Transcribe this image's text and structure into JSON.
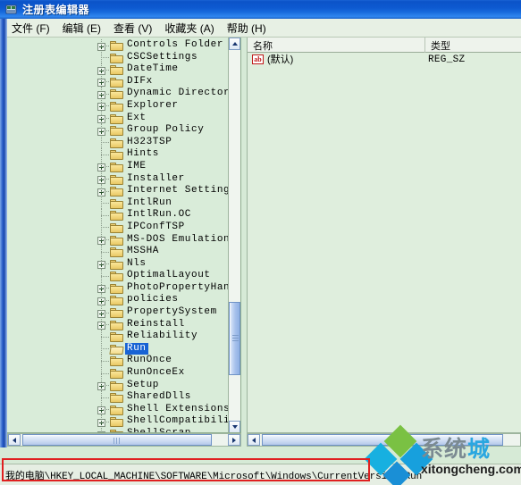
{
  "window": {
    "title": "注册表编辑器",
    "icon": "registry-editor-icon"
  },
  "menubar": {
    "items": [
      {
        "label": "文件 (F)",
        "name": "file"
      },
      {
        "label": "编辑 (E)",
        "name": "edit"
      },
      {
        "label": "查看 (V)",
        "name": "view"
      },
      {
        "label": "收藏夹 (A)",
        "name": "favorites"
      },
      {
        "label": "帮助 (H)",
        "name": "help"
      }
    ]
  },
  "tree": {
    "nodes": [
      {
        "label": "Controls Folder",
        "expandable": true,
        "selected": false
      },
      {
        "label": "CSCSettings",
        "expandable": false,
        "selected": false
      },
      {
        "label": "DateTime",
        "expandable": true,
        "selected": false
      },
      {
        "label": "DIFx",
        "expandable": true,
        "selected": false
      },
      {
        "label": "Dynamic Directory",
        "expandable": true,
        "selected": false
      },
      {
        "label": "Explorer",
        "expandable": true,
        "selected": false
      },
      {
        "label": "Ext",
        "expandable": true,
        "selected": false
      },
      {
        "label": "Group Policy",
        "expandable": true,
        "selected": false
      },
      {
        "label": "H323TSP",
        "expandable": false,
        "selected": false
      },
      {
        "label": "Hints",
        "expandable": false,
        "selected": false
      },
      {
        "label": "IME",
        "expandable": true,
        "selected": false
      },
      {
        "label": "Installer",
        "expandable": true,
        "selected": false
      },
      {
        "label": "Internet Settings",
        "expandable": true,
        "selected": false
      },
      {
        "label": "IntlRun",
        "expandable": false,
        "selected": false
      },
      {
        "label": "IntlRun.OC",
        "expandable": false,
        "selected": false
      },
      {
        "label": "IPConfTSP",
        "expandable": false,
        "selected": false
      },
      {
        "label": "MS-DOS Emulation",
        "expandable": true,
        "selected": false
      },
      {
        "label": "MSSHA",
        "expandable": false,
        "selected": false
      },
      {
        "label": "Nls",
        "expandable": true,
        "selected": false
      },
      {
        "label": "OptimalLayout",
        "expandable": false,
        "selected": false
      },
      {
        "label": "PhotoPropertyHandler",
        "expandable": true,
        "selected": false
      },
      {
        "label": "policies",
        "expandable": true,
        "selected": false
      },
      {
        "label": "PropertySystem",
        "expandable": true,
        "selected": false
      },
      {
        "label": "Reinstall",
        "expandable": true,
        "selected": false
      },
      {
        "label": "Reliability",
        "expandable": false,
        "selected": false
      },
      {
        "label": "Run",
        "expandable": false,
        "selected": true
      },
      {
        "label": "RunOnce",
        "expandable": false,
        "selected": false
      },
      {
        "label": "RunOnceEx",
        "expandable": false,
        "selected": false
      },
      {
        "label": "Setup",
        "expandable": true,
        "selected": false
      },
      {
        "label": "SharedDlls",
        "expandable": false,
        "selected": false
      },
      {
        "label": "Shell Extensions",
        "expandable": true,
        "selected": false
      },
      {
        "label": "ShellCompatibility",
        "expandable": true,
        "selected": false
      },
      {
        "label": "ShellScrap",
        "expandable": true,
        "selected": false
      }
    ]
  },
  "list": {
    "columns": [
      {
        "label": "名称",
        "name": "name"
      },
      {
        "label": "类型",
        "name": "type"
      }
    ],
    "rows": [
      {
        "name": "(默认)",
        "type": "REG_SZ",
        "icon": "ab-string-icon"
      }
    ]
  },
  "statusbar": {
    "path": "我的电脑\\HKEY_LOCAL_MACHINE\\SOFTWARE\\Microsoft\\Windows\\CurrentVersion\\Run"
  },
  "watermark": {
    "brand_cn_dark": "系统",
    "brand_cn_blue": "城",
    "domain": "xitongcheng.com"
  },
  "colors": {
    "titlebar_blue": "#0d59d0",
    "selection_blue": "#1863d4",
    "pane_bg": "#d9ecd9",
    "highlight_red": "#e02020",
    "folder_yellow": "#e8c864"
  }
}
